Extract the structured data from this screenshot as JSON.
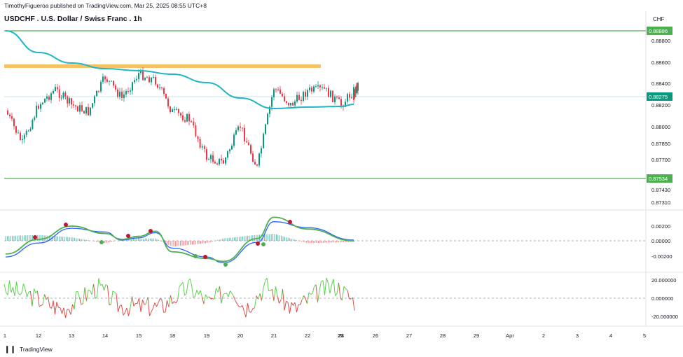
{
  "header": {
    "publisher_line": "TimothyFigueroa published on TradingView.com, Mar 25, 2025 08:55 UTC+8",
    "symbol_title": "USDCHF . U.S. Dollar / Swiss Franc . 1h",
    "currency": "CHF"
  },
  "footer": {
    "brand_logo": "❙❙",
    "brand_name": "TradingView"
  },
  "colors": {
    "up": "#089981",
    "down": "#f23645",
    "ma": "#22b5c4",
    "resistance_zone": "#f5c265",
    "level_line": "#4caf50",
    "macd_fast": "#4caf50",
    "macd_slow": "#2962ff",
    "hist_up": "#5fbcb0",
    "hist_down": "#f77c80",
    "osc_up": "#5bd14b",
    "osc_down": "#e14b45",
    "price_label": "#089981"
  },
  "chart_data": [
    {
      "type": "candlestick",
      "panel": "price",
      "y_ticks": [
        "0.88800",
        "0.88600",
        "0.88400",
        "0.88200",
        "0.88000",
        "0.87850",
        "0.87700",
        "0.87430",
        "0.87310"
      ],
      "ylim": [
        0.8726,
        0.8896
      ],
      "x_ticks": [
        "1",
        "12",
        "13",
        "14",
        "15",
        "18",
        "19",
        "20",
        "21",
        "22",
        "24",
        "25",
        "26",
        "27",
        "28",
        "29",
        "Apr",
        "2",
        "3",
        "4",
        "5"
      ],
      "x_tick_dates": [
        "Mar 11",
        "Mar 12",
        "Mar 13",
        "Mar 14",
        "Mar 15",
        "Mar 18",
        "Mar 19",
        "Mar 20",
        "Mar 21",
        "Mar 22",
        "Mar 24",
        "Mar 25",
        "Mar 26",
        "Mar 27",
        "Mar 28",
        "Mar 29",
        "Apr 1",
        "Apr 2",
        "Apr 3",
        "Apr 4",
        "Apr 5"
      ],
      "levels": [
        {
          "value": 0.88886,
          "label": "0.88886"
        },
        {
          "value": 0.87534,
          "label": "0.87534"
        }
      ],
      "last_price": {
        "value": 0.88275,
        "label": "0.88275"
      },
      "resistance_zone": {
        "low": 0.88545,
        "high": 0.88585,
        "from": "Mar 11",
        "to": "Mar 24"
      },
      "moving_average": [
        [
          "Mar 11",
          0.8893
        ],
        [
          "Mar 12",
          0.8878
        ],
        [
          "Mar 13",
          0.8868
        ],
        [
          "Mar 14",
          0.886
        ],
        [
          "Mar 15",
          0.8858
        ],
        [
          "Mar 18",
          0.885
        ],
        [
          "Mar 19",
          0.8838
        ],
        [
          "Mar 20",
          0.8827
        ],
        [
          "Mar 21",
          0.8819
        ],
        [
          "Mar 22",
          0.882
        ],
        [
          "Mar 24",
          0.8817
        ],
        [
          "Mar 25",
          0.882
        ]
      ],
      "close_path": [
        [
          "Mar 11",
          0.882
        ],
        [
          "Mar 11 12h",
          0.8782
        ],
        [
          "Mar 12",
          0.8826
        ],
        [
          "Mar 12 12h",
          0.8836
        ],
        [
          "Mar 13",
          0.8826
        ],
        [
          "Mar 13 12h",
          0.8815
        ],
        [
          "Mar 14",
          0.8856
        ],
        [
          "Mar 14 12h",
          0.8831
        ],
        [
          "Mar 15",
          0.8852
        ],
        [
          "Mar 15 12h",
          0.8846
        ],
        [
          "Mar 18",
          0.8818
        ],
        [
          "Mar 18 12h",
          0.8812
        ],
        [
          "Mar 19",
          0.8775
        ],
        [
          "Mar 19 12h",
          0.8772
        ],
        [
          "Mar 20",
          0.88
        ],
        [
          "Mar 20 12h",
          0.8764
        ],
        [
          "Mar 21",
          0.8835
        ],
        [
          "Mar 21 12h",
          0.882
        ],
        [
          "Mar 22",
          0.8832
        ],
        [
          "Mar 22 12h",
          0.8833
        ],
        [
          "Mar 24",
          0.8826
        ],
        [
          "Mar 24 12h",
          0.8842
        ],
        [
          "Mar 25",
          0.883
        ]
      ]
    },
    {
      "type": "line",
      "panel": "macd",
      "y_ticks": [
        "0.00200",
        "0.00000",
        "-0.00200"
      ],
      "ylim": [
        -0.0038,
        0.0036
      ],
      "series": [
        {
          "role": "fast",
          "values": [
            -0.0018,
            0.0002,
            0.002,
            0.001,
            0.0002,
            0.0006,
            0.0013,
            -0.0015,
            -0.0024,
            -0.0028,
            0.0003,
            0.0032,
            0.0016,
            0.0
          ]
        },
        {
          "role": "slow",
          "values": [
            -0.0022,
            -0.0003,
            0.0017,
            0.0012,
            0.0001,
            0.0004,
            0.0011,
            -0.001,
            -0.0022,
            -0.003,
            -0.0002,
            0.0026,
            0.0018,
            0.0001
          ]
        }
      ],
      "x": [
        "Mar 11",
        "Mar 12",
        "Mar 13",
        "Mar 14",
        "Mar 14 12h",
        "Mar 15",
        "Mar 15 12h",
        "Mar 18",
        "Mar 19",
        "Mar 19 12h",
        "Mar 20 12h",
        "Mar 21",
        "Mar 22",
        "Mar 25"
      ]
    },
    {
      "type": "line",
      "panel": "oscillator",
      "y_ticks": [
        "20.000000",
        "0.000000",
        "-20.000000"
      ],
      "ylim": [
        -30,
        30
      ],
      "zero_line": 0
    }
  ]
}
